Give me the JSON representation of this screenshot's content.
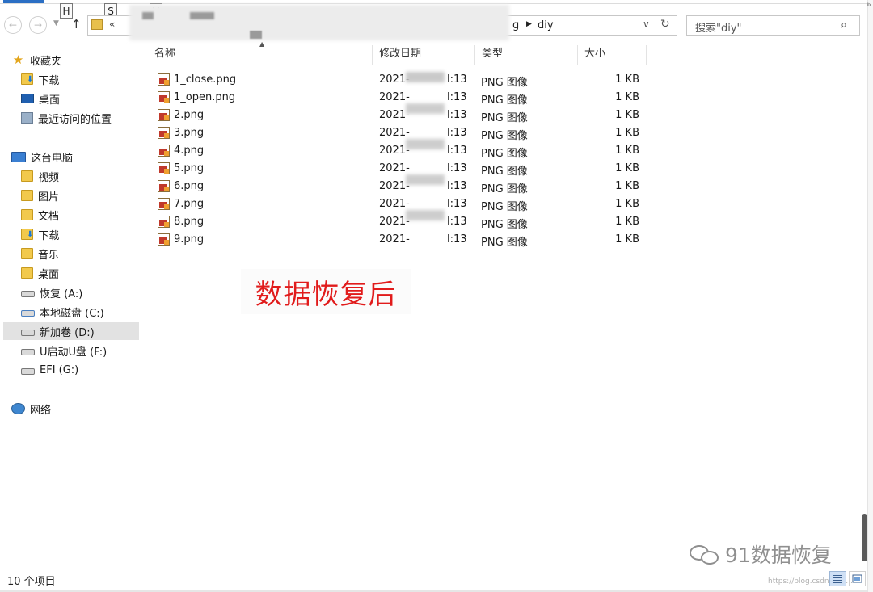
{
  "keytips": [
    "H",
    "S",
    "V"
  ],
  "address": {
    "prefix": "«",
    "folder_partial": "g",
    "current": "diy"
  },
  "search": {
    "text": "搜索\"diy\""
  },
  "sidebar": {
    "favorites": {
      "label": "收藏夹",
      "items": [
        {
          "label": "下载",
          "icon": "download-folder-icon"
        },
        {
          "label": "桌面",
          "icon": "desktop-icon"
        },
        {
          "label": "最近访问的位置",
          "icon": "recent-places-icon"
        }
      ]
    },
    "pc": {
      "label": "这台电脑",
      "items": [
        {
          "label": "视频",
          "icon": "video-folder-icon"
        },
        {
          "label": "图片",
          "icon": "pictures-folder-icon"
        },
        {
          "label": "文档",
          "icon": "documents-folder-icon"
        },
        {
          "label": "下载",
          "icon": "download-folder-icon"
        },
        {
          "label": "音乐",
          "icon": "music-folder-icon"
        },
        {
          "label": "桌面",
          "icon": "desktop-folder-icon"
        },
        {
          "label": "恢复 (A:)",
          "icon": "drive-icon"
        },
        {
          "label": "本地磁盘 (C:)",
          "icon": "system-drive-icon"
        },
        {
          "label": "新加卷 (D:)",
          "icon": "drive-icon",
          "selected": true
        },
        {
          "label": "U启动U盘 (F:)",
          "icon": "usb-drive-icon"
        },
        {
          "label": "EFI (G:)",
          "icon": "drive-icon"
        }
      ]
    },
    "network": {
      "label": "网络"
    }
  },
  "columns": {
    "name": "名称",
    "date": "修改日期",
    "type": "类型",
    "size": "大小"
  },
  "files": [
    {
      "name": "1_close.png",
      "date_prefix": "2021-",
      "date_suffix": "l:13",
      "type": "PNG 图像",
      "size": "1 KB"
    },
    {
      "name": "1_open.png",
      "date_prefix": "2021-",
      "date_suffix": "l:13",
      "type": "PNG 图像",
      "size": "1 KB"
    },
    {
      "name": "2.png",
      "date_prefix": "2021-",
      "date_suffix": "l:13",
      "type": "PNG 图像",
      "size": "1 KB"
    },
    {
      "name": "3.png",
      "date_prefix": "2021-",
      "date_suffix": "l:13",
      "type": "PNG 图像",
      "size": "1 KB"
    },
    {
      "name": "4.png",
      "date_prefix": "2021-",
      "date_suffix": "l:13",
      "type": "PNG 图像",
      "size": "1 KB"
    },
    {
      "name": "5.png",
      "date_prefix": "2021-",
      "date_suffix": "l:13",
      "type": "PNG 图像",
      "size": "1 KB"
    },
    {
      "name": "6.png",
      "date_prefix": "2021-",
      "date_suffix": "l:13",
      "type": "PNG 图像",
      "size": "1 KB"
    },
    {
      "name": "7.png",
      "date_prefix": "2021-",
      "date_suffix": "l:13",
      "type": "PNG 图像",
      "size": "1 KB"
    },
    {
      "name": "8.png",
      "date_prefix": "2021-",
      "date_suffix": "l:13",
      "type": "PNG 图像",
      "size": "1 KB"
    },
    {
      "name": "9.png",
      "date_prefix": "2021-",
      "date_suffix": "l:13",
      "type": "PNG 图像",
      "size": "1 KB"
    }
  ],
  "annotation": "数据恢复后",
  "watermark": {
    "text": "91数据恢复",
    "small": "https://blog.csdn.net/..."
  },
  "status": {
    "item_count": "10 个项目"
  },
  "colors": {
    "annotation": "#e11b1b",
    "accent": "#2b6fc4",
    "selection": "#e2e2e2"
  }
}
